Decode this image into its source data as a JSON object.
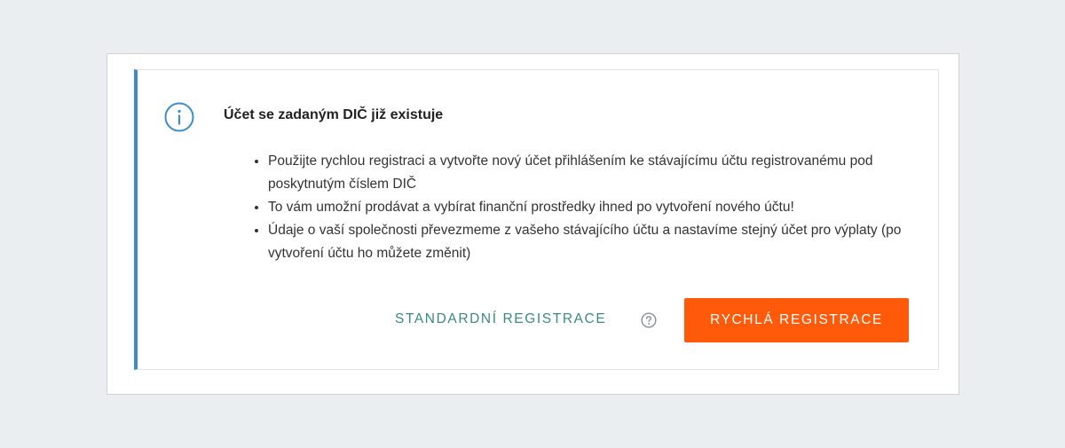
{
  "alert": {
    "icon": "info-icon",
    "title": "Účet se zadaným DIČ již existuje",
    "bullets": [
      "Použijte rychlou registraci a vytvořte nový účet přihlášením ke stávajícímu účtu registrovanému pod poskytnutým číslem DIČ",
      "To vám umožní prodávat a vybírat finanční prostředky ihned po vytvoření nového účtu!",
      "Údaje o vaší společnosti převezmeme z vašeho stávajícího účtu a nastavíme stejný účet pro výplaty (po vytvoření účtu ho můžete změnit)"
    ]
  },
  "actions": {
    "standard_label": "STANDARDNÍ REGISTRACE",
    "help_icon": "question-circle-icon",
    "fast_label": "RYCHLÁ REGISTRACE"
  },
  "colors": {
    "accent_border": "#3c8dc5",
    "link": "#3a8a82",
    "primary_button": "#ff5a0a",
    "page_background": "#ebeef1"
  }
}
